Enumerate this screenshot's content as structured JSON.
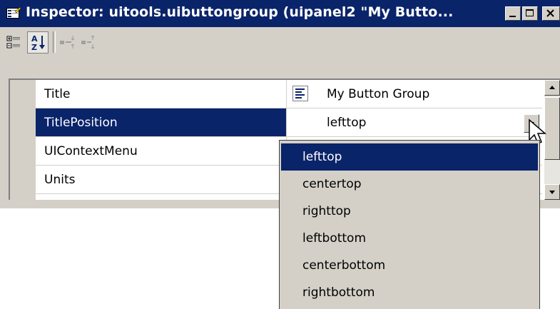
{
  "window": {
    "title": "Inspector:  uitools.uibuttongroup (uipanel2 \"My Butto..."
  },
  "toolbar": {
    "buttons": [
      {
        "name": "categorized-icon"
      },
      {
        "name": "sort-alphabetical-icon"
      },
      {
        "name": "expand-all-icon"
      },
      {
        "name": "collapse-all-icon"
      }
    ]
  },
  "properties": [
    {
      "name": "Title",
      "value": "My Button Group",
      "value_icon": "text-align-left-icon"
    },
    {
      "name": "TitlePosition",
      "value": "lefttop",
      "selected": true
    },
    {
      "name": "UIContextMenu",
      "value": ""
    },
    {
      "name": "Units",
      "value": ""
    }
  ],
  "dropdown": {
    "options": [
      "lefttop",
      "centertop",
      "righttop",
      "leftbottom",
      "centerbottom",
      "rightbottom"
    ],
    "selected": "lefttop"
  },
  "colors": {
    "selection": "#0a246a",
    "face": "#d4d0c8"
  }
}
